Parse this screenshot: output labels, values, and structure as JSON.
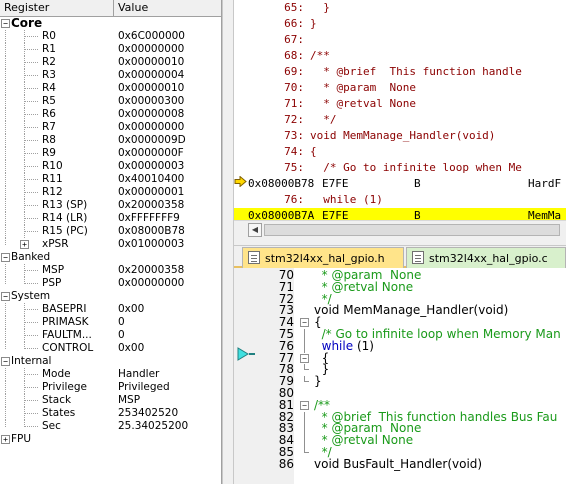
{
  "registers": {
    "header": {
      "register": "Register",
      "value": "Value"
    },
    "groups": {
      "core": "Core",
      "banked": "Banked",
      "system": "System",
      "internal": "Internal",
      "fpu": "FPU"
    },
    "expand_symbols": {
      "expanded": "−",
      "collapsed": "+"
    },
    "core": [
      {
        "name": "R0",
        "value": "0x6C000000"
      },
      {
        "name": "R1",
        "value": "0x00000000"
      },
      {
        "name": "R2",
        "value": "0x00000010"
      },
      {
        "name": "R3",
        "value": "0x00000004"
      },
      {
        "name": "R4",
        "value": "0x00000010"
      },
      {
        "name": "R5",
        "value": "0x00000300"
      },
      {
        "name": "R6",
        "value": "0x00000008"
      },
      {
        "name": "R7",
        "value": "0x00000000"
      },
      {
        "name": "R8",
        "value": "0x0000009D"
      },
      {
        "name": "R9",
        "value": "0x0000000F"
      },
      {
        "name": "R10",
        "value": "0x00000003"
      },
      {
        "name": "R11",
        "value": "0x40010400"
      },
      {
        "name": "R12",
        "value": "0x00000001"
      },
      {
        "name": "R13 (SP)",
        "value": "0x20000358"
      },
      {
        "name": "R14 (LR)",
        "value": "0xFFFFFFF9"
      },
      {
        "name": "R15 (PC)",
        "value": "0x08000B78"
      },
      {
        "name": "xPSR",
        "value": "0x01000003"
      }
    ],
    "banked": [
      {
        "name": "MSP",
        "value": "0x20000358"
      },
      {
        "name": "PSP",
        "value": "0x00000000"
      }
    ],
    "system": [
      {
        "name": "BASEPRI",
        "value": "0x00"
      },
      {
        "name": "PRIMASK",
        "value": "0"
      },
      {
        "name": "FAULTM...",
        "value": "0"
      },
      {
        "name": "CONTROL",
        "value": "0x00"
      }
    ],
    "internal": [
      {
        "name": "Mode",
        "value": "Handler"
      },
      {
        "name": "Privilege",
        "value": "Privileged"
      },
      {
        "name": "Stack",
        "value": "MSP"
      },
      {
        "name": "States",
        "value": "253402520"
      },
      {
        "name": "Sec",
        "value": "25.34025200"
      }
    ]
  },
  "disassembly": {
    "lines": [
      {
        "kind": "src",
        "num": "65:",
        "text": "  }"
      },
      {
        "kind": "src",
        "num": "66:",
        "text": "}"
      },
      {
        "kind": "src",
        "num": "67:",
        "text": ""
      },
      {
        "kind": "src",
        "num": "68:",
        "text": "/**"
      },
      {
        "kind": "src",
        "num": "69:",
        "text": "  * @brief  This function handle"
      },
      {
        "kind": "src",
        "num": "70:",
        "text": "  * @param  None"
      },
      {
        "kind": "src",
        "num": "71:",
        "text": "  * @retval None"
      },
      {
        "kind": "src",
        "num": "72:",
        "text": "  */"
      },
      {
        "kind": "src",
        "num": "73:",
        "text": "void MemManage_Handler(void)"
      },
      {
        "kind": "src",
        "num": "74:",
        "text": "{"
      },
      {
        "kind": "src",
        "num": "75:",
        "text": "  /* Go to infinite loop when Me"
      },
      {
        "kind": "asm",
        "addr": "0x08000B78",
        "hex": "E7FE",
        "mn": "B",
        "op": "HardF"
      },
      {
        "kind": "src",
        "num": "76:",
        "text": "  while (1)"
      },
      {
        "kind": "asm",
        "addr": "0x08000B7A",
        "hex": "E7FE",
        "mn": "B",
        "op": "MemMa",
        "highlight": true
      }
    ],
    "highlight_color": "#ffff00"
  },
  "scroll_arrows": {
    "left": "◀"
  },
  "tabs": [
    {
      "label": "stm32l4xx_hal_gpio.h",
      "color": "#ffe48a"
    },
    {
      "label": "stm32l4xx_hal_gpio.c",
      "color": "#d8f0cc"
    }
  ],
  "fold_symbols": {
    "open": "−"
  },
  "editor": {
    "lines": [
      {
        "num": "70",
        "code": "  * @param  None",
        "cmt": true
      },
      {
        "num": "71",
        "code": "  * @retval None",
        "cmt": true
      },
      {
        "num": "72",
        "code": "  */",
        "cmt": true
      },
      {
        "num": "73",
        "code": "void MemManage_Handler(void)",
        "cmt": false
      },
      {
        "num": "74",
        "code": "{",
        "cmt": false,
        "fold": "open"
      },
      {
        "num": "75",
        "code": "  /* Go to infinite loop when Memory Man",
        "cmt": true
      },
      {
        "num": "76",
        "code": "  while (1)",
        "cmt": false,
        "kw": "while"
      },
      {
        "num": "77",
        "code": "  {",
        "cmt": false,
        "fold": "open"
      },
      {
        "num": "78",
        "code": "  }",
        "cmt": false,
        "fold": "end"
      },
      {
        "num": "79",
        "code": "}",
        "cmt": false,
        "fold": "end"
      },
      {
        "num": "80",
        "code": "",
        "cmt": false
      },
      {
        "num": "81",
        "code": "/**",
        "cmt": true,
        "fold": "open"
      },
      {
        "num": "82",
        "code": "  * @brief  This function handles Bus Fau",
        "cmt": true
      },
      {
        "num": "83",
        "code": "  * @param  None",
        "cmt": true
      },
      {
        "num": "84",
        "code": "  * @retval None",
        "cmt": true
      },
      {
        "num": "85",
        "code": "  */",
        "cmt": true,
        "fold": "end"
      },
      {
        "num": "86",
        "code": "void BusFault_Handler(void)",
        "cmt": false
      }
    ],
    "comment_color": "#1a9a1a",
    "keyword_color": "#0000c0"
  }
}
